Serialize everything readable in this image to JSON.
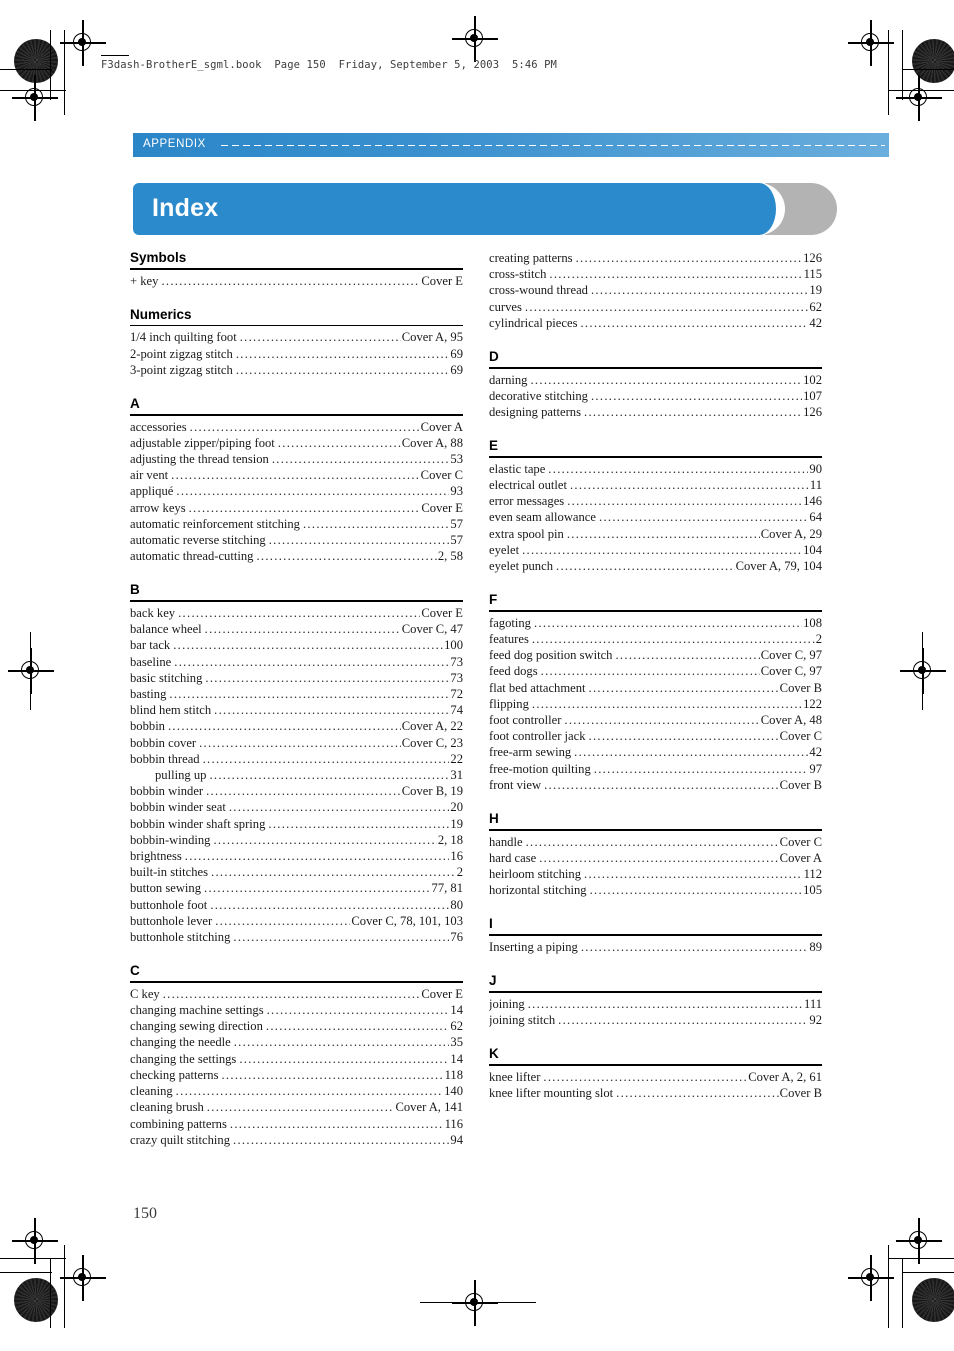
{
  "file_header": "F3dash-BrotherE_sgml.book  Page 150  Friday, September 5, 2003  5:46 PM",
  "running_head": {
    "label": "APPENDIX"
  },
  "title": {
    "text": "Index"
  },
  "page_number": "150",
  "colors": {
    "accent_blue": "#2b8acb",
    "gray_tab": "#b3b3b3",
    "header_gradient_start": "#2b86c8",
    "header_gradient_end": "#6aaedd"
  },
  "columns": [
    {
      "sections": [
        {
          "letter": "Symbols",
          "entries": [
            {
              "term": "+ key",
              "pages": "Cover E",
              "sub": false
            }
          ]
        },
        {
          "letter": "Numerics",
          "entries": [
            {
              "term": "1/4 inch quilting foot",
              "pages": "Cover A, 95",
              "sub": false
            },
            {
              "term": "2-point zigzag stitch",
              "pages": "69",
              "sub": false
            },
            {
              "term": "3-point zigzag stitch",
              "pages": "69",
              "sub": false
            }
          ]
        },
        {
          "letter": "A",
          "entries": [
            {
              "term": "accessories",
              "pages": "Cover A",
              "sub": false
            },
            {
              "term": "adjustable zipper/piping foot",
              "pages": "Cover A, 88",
              "sub": false
            },
            {
              "term": "adjusting the thread tension",
              "pages": "53",
              "sub": false
            },
            {
              "term": "air vent",
              "pages": "Cover C",
              "sub": false
            },
            {
              "term": "appliqué",
              "pages": "93",
              "sub": false
            },
            {
              "term": "arrow keys",
              "pages": "Cover E",
              "sub": false
            },
            {
              "term": "automatic reinforcement stitching",
              "pages": "57",
              "sub": false
            },
            {
              "term": "automatic reverse stitching",
              "pages": "57",
              "sub": false
            },
            {
              "term": "automatic thread-cutting",
              "pages": "2, 58",
              "sub": false
            }
          ]
        },
        {
          "letter": "B",
          "entries": [
            {
              "term": "back key",
              "pages": "Cover E",
              "sub": false
            },
            {
              "term": "balance wheel",
              "pages": "Cover C, 47",
              "sub": false
            },
            {
              "term": "bar tack",
              "pages": "100",
              "sub": false
            },
            {
              "term": "baseline",
              "pages": "73",
              "sub": false
            },
            {
              "term": "basic stitching",
              "pages": "73",
              "sub": false
            },
            {
              "term": "basting",
              "pages": "72",
              "sub": false
            },
            {
              "term": "blind hem stitch",
              "pages": "74",
              "sub": false
            },
            {
              "term": "bobbin",
              "pages": "Cover A, 22",
              "sub": false
            },
            {
              "term": "bobbin cover",
              "pages": "Cover C, 23",
              "sub": false
            },
            {
              "term": "bobbin thread",
              "pages": "22",
              "sub": false
            },
            {
              "term": "pulling up",
              "pages": "31",
              "sub": true
            },
            {
              "term": "bobbin winder",
              "pages": "Cover B, 19",
              "sub": false
            },
            {
              "term": "bobbin winder seat",
              "pages": "20",
              "sub": false
            },
            {
              "term": "bobbin winder shaft spring",
              "pages": "19",
              "sub": false
            },
            {
              "term": "bobbin-winding",
              "pages": "2, 18",
              "sub": false
            },
            {
              "term": "brightness",
              "pages": "16",
              "sub": false
            },
            {
              "term": "built-in stitches",
              "pages": "2",
              "sub": false
            },
            {
              "term": "button sewing",
              "pages": "77, 81",
              "sub": false
            },
            {
              "term": "buttonhole foot",
              "pages": "80",
              "sub": false
            },
            {
              "term": "buttonhole lever",
              "pages": "Cover C, 78, 101, 103",
              "sub": false
            },
            {
              "term": "buttonhole stitching",
              "pages": "76",
              "sub": false
            }
          ]
        },
        {
          "letter": "C",
          "entries": [
            {
              "term": "C key",
              "pages": "Cover E",
              "sub": false
            },
            {
              "term": "changing machine settings",
              "pages": "14",
              "sub": false
            },
            {
              "term": "changing sewing direction",
              "pages": "62",
              "sub": false
            },
            {
              "term": "changing the needle",
              "pages": "35",
              "sub": false
            },
            {
              "term": "changing the settings",
              "pages": "14",
              "sub": false
            },
            {
              "term": "checking patterns",
              "pages": "118",
              "sub": false
            },
            {
              "term": "cleaning",
              "pages": "140",
              "sub": false
            },
            {
              "term": "cleaning brush",
              "pages": "Cover A, 141",
              "sub": false
            },
            {
              "term": "combining patterns",
              "pages": "116",
              "sub": false
            },
            {
              "term": "crazy quilt stitching",
              "pages": "94",
              "sub": false
            }
          ]
        }
      ]
    },
    {
      "sections": [
        {
          "letter": "",
          "entries": [
            {
              "term": "creating patterns",
              "pages": "126",
              "sub": false
            },
            {
              "term": "cross-stitch",
              "pages": "115",
              "sub": false
            },
            {
              "term": "cross-wound thread",
              "pages": "19",
              "sub": false
            },
            {
              "term": "curves",
              "pages": "62",
              "sub": false
            },
            {
              "term": "cylindrical pieces",
              "pages": "42",
              "sub": false
            }
          ]
        },
        {
          "letter": "D",
          "entries": [
            {
              "term": "darning",
              "pages": "102",
              "sub": false
            },
            {
              "term": "decorative stitching",
              "pages": "107",
              "sub": false
            },
            {
              "term": "designing patterns",
              "pages": "126",
              "sub": false
            }
          ]
        },
        {
          "letter": "E",
          "entries": [
            {
              "term": "elastic tape",
              "pages": "90",
              "sub": false
            },
            {
              "term": "electrical outlet",
              "pages": "11",
              "sub": false
            },
            {
              "term": "error messages",
              "pages": "146",
              "sub": false
            },
            {
              "term": "even seam allowance",
              "pages": "64",
              "sub": false
            },
            {
              "term": "extra spool pin",
              "pages": "Cover A, 29",
              "sub": false
            },
            {
              "term": "eyelet",
              "pages": "104",
              "sub": false
            },
            {
              "term": "eyelet punch",
              "pages": "Cover A, 79, 104",
              "sub": false
            }
          ]
        },
        {
          "letter": "F",
          "entries": [
            {
              "term": "fagoting",
              "pages": "108",
              "sub": false
            },
            {
              "term": "features",
              "pages": "2",
              "sub": false
            },
            {
              "term": "feed dog position switch",
              "pages": "Cover C, 97",
              "sub": false
            },
            {
              "term": "feed dogs",
              "pages": "Cover C, 97",
              "sub": false
            },
            {
              "term": "flat bed attachment",
              "pages": "Cover B",
              "sub": false
            },
            {
              "term": "flipping",
              "pages": "122",
              "sub": false
            },
            {
              "term": "foot controller",
              "pages": "Cover A, 48",
              "sub": false
            },
            {
              "term": "foot controller jack",
              "pages": "Cover C",
              "sub": false
            },
            {
              "term": "free-arm sewing",
              "pages": "42",
              "sub": false
            },
            {
              "term": "free-motion quilting",
              "pages": "97",
              "sub": false
            },
            {
              "term": "front view",
              "pages": "Cover B",
              "sub": false
            }
          ]
        },
        {
          "letter": "H",
          "entries": [
            {
              "term": "handle",
              "pages": "Cover C",
              "sub": false
            },
            {
              "term": "hard case",
              "pages": "Cover A",
              "sub": false
            },
            {
              "term": "heirloom stitching",
              "pages": "112",
              "sub": false
            },
            {
              "term": "horizontal stitching",
              "pages": "105",
              "sub": false
            }
          ]
        },
        {
          "letter": "I",
          "entries": [
            {
              "term": "Inserting a piping",
              "pages": "89",
              "sub": false
            }
          ]
        },
        {
          "letter": "J",
          "entries": [
            {
              "term": "joining",
              "pages": "111",
              "sub": false
            },
            {
              "term": "joining stitch",
              "pages": "92",
              "sub": false
            }
          ]
        },
        {
          "letter": "K",
          "entries": [
            {
              "term": "knee lifter",
              "pages": "Cover A, 2, 61",
              "sub": false
            },
            {
              "term": "knee lifter mounting slot",
              "pages": "Cover B",
              "sub": false
            }
          ]
        }
      ]
    }
  ]
}
